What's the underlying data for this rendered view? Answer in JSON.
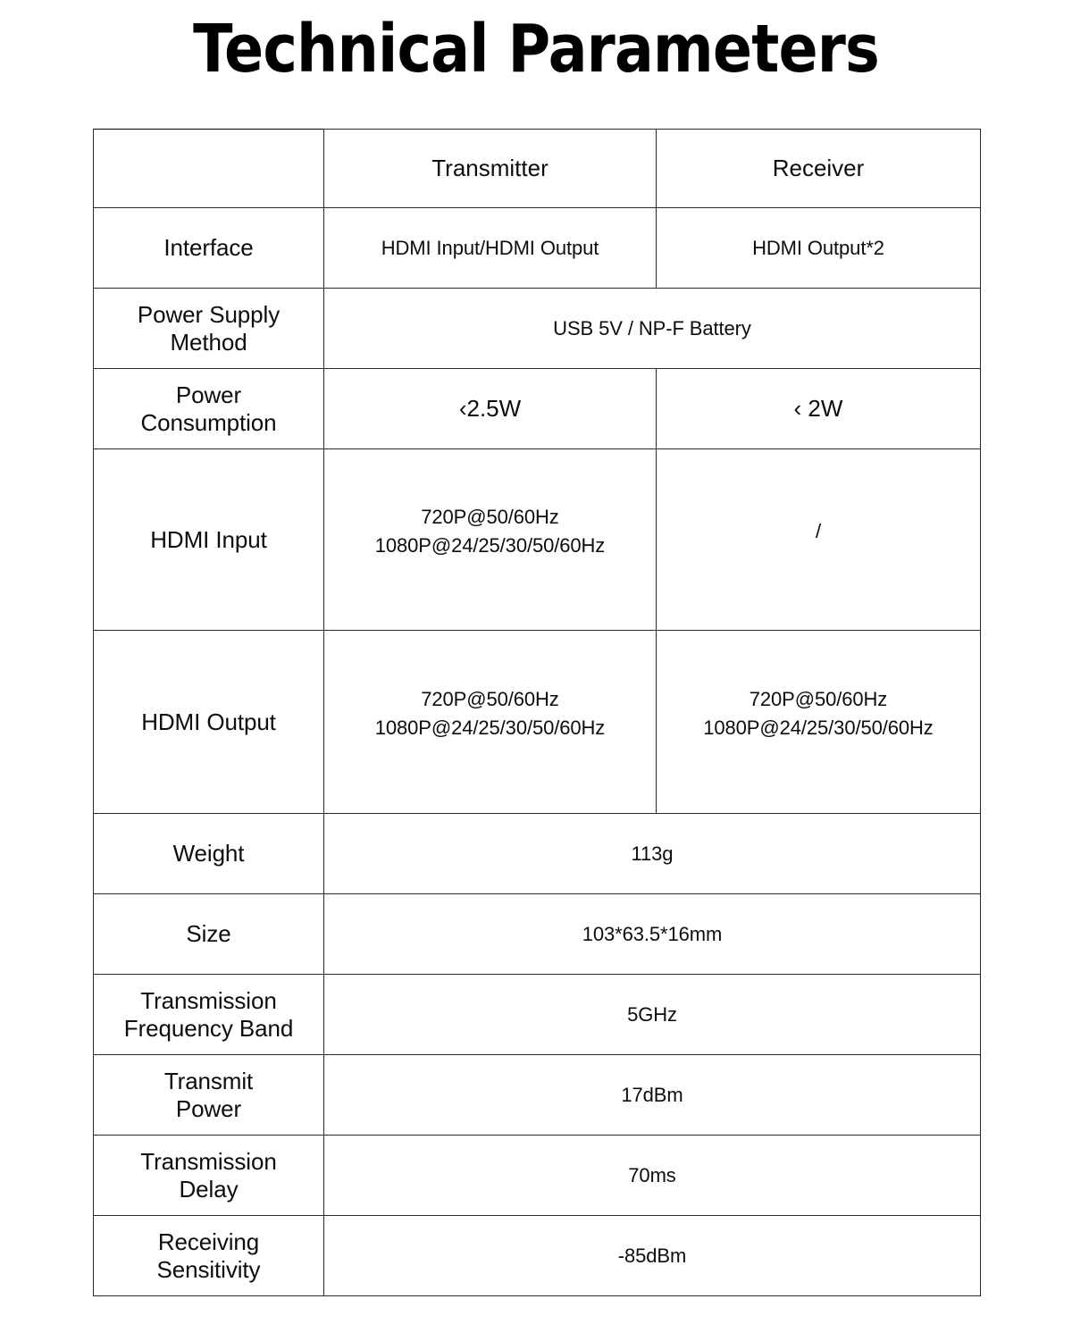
{
  "page": {
    "title": "Technical Parameters",
    "background_color": "#ffffff",
    "text_color": "#101010",
    "border_color": "#2a2a2a"
  },
  "table": {
    "columns": [
      "",
      "Transmitter",
      "Receiver"
    ],
    "header": {
      "blank": "",
      "transmitter": "Transmitter",
      "receiver": "Receiver"
    },
    "rows": [
      {
        "label": "Interface",
        "transmitter": "HDMI Input/HDMI Output",
        "receiver": "HDMI Output*2",
        "span": false
      },
      {
        "label": "Power Supply\nMethod",
        "value": "USB 5V / NP-F Battery",
        "span": true
      },
      {
        "label": "Power\nConsumption",
        "transmitter": "‹2.5W",
        "receiver": "‹ 2W",
        "span": false
      },
      {
        "label": "HDMI Input",
        "transmitter": "720P@50/60Hz\n1080P@24/25/30/50/60Hz",
        "receiver": "/",
        "span": false
      },
      {
        "label": "HDMI Output",
        "transmitter": "720P@50/60Hz\n1080P@24/25/30/50/60Hz",
        "receiver": "720P@50/60Hz\n1080P@24/25/30/50/60Hz",
        "span": false
      },
      {
        "label": "Weight",
        "value": "113g",
        "span": true
      },
      {
        "label": "Size",
        "value": "103*63.5*16mm",
        "span": true
      },
      {
        "label": "Transmission\nFrequency Band",
        "value": "5GHz",
        "span": true
      },
      {
        "label": "Transmit\nPower",
        "value": "17dBm",
        "span": true
      },
      {
        "label": "Transmission\nDelay",
        "value": "70ms",
        "span": true
      },
      {
        "label": "Receiving\nSensitivity",
        "value": "-85dBm",
        "span": true
      }
    ]
  }
}
